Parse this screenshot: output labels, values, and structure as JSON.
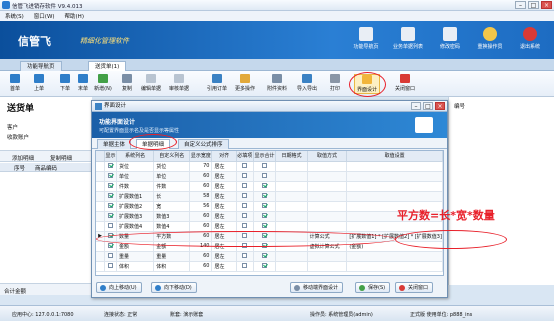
{
  "window": {
    "title": "信管飞进销存软件 V9.4.013",
    "controls": [
      "–",
      "□",
      "×"
    ]
  },
  "menu": [
    "系统(S)",
    "窗口(W)",
    "帮助(H)"
  ],
  "banner": {
    "brand": "信管飞",
    "slogan": "精细化管理软件",
    "buttons": [
      "功能导航页",
      "业务单据列表",
      "修改密码",
      "重换操作员",
      "退出系统"
    ]
  },
  "tabs": [
    "功能导航页",
    "送货单(1)"
  ],
  "toolbar": [
    "首单",
    "上单",
    "下单",
    "末单",
    "新增(N)",
    "复制",
    "编辑单据",
    "审核单据",
    "引用订单",
    "更多操作",
    "附件资料",
    "导入导出",
    "打印",
    "界面设计",
    "关闭窗口"
  ],
  "doc": {
    "title": "送货单",
    "label_customer": "客户",
    "label_account": "收款账户",
    "btn_add_row": "添加明细",
    "btn_copy_row": "复制明细",
    "col_no": "序号",
    "col_code": "商品编码",
    "total_label": "合计金额",
    "right_label": "编号"
  },
  "dialog": {
    "title": "界面设计",
    "header_title": "功能界面设计",
    "header_desc": "可配置界面显示名及是否显示等属性",
    "tabs": [
      "单据主体",
      "单据明细",
      "自定义公式排序"
    ],
    "columns": [
      "显示",
      "系统列名",
      "自定义列名",
      "显示宽度",
      "对齐",
      "必填项",
      "显示合计",
      "日期格式",
      "取值方式",
      "取值设置"
    ],
    "rows": [
      {
        "show": true,
        "sys": "货位",
        "custom": "货位",
        "width": "70",
        "align": "居左",
        "required": false,
        "total": false,
        "date": "",
        "mode": "",
        "setting": ""
      },
      {
        "show": true,
        "sys": "单位",
        "custom": "单位",
        "width": "60",
        "align": "居左",
        "required": false,
        "total": false,
        "date": "",
        "mode": "",
        "setting": ""
      },
      {
        "show": true,
        "sys": "件数",
        "custom": "件数",
        "width": "60",
        "align": "居左",
        "required": false,
        "total": true,
        "date": "",
        "mode": "",
        "setting": ""
      },
      {
        "show": true,
        "sys": "扩展数值1",
        "custom": "长",
        "width": "58",
        "align": "居左",
        "required": false,
        "total": true,
        "date": "",
        "mode": "",
        "setting": ""
      },
      {
        "show": true,
        "sys": "扩展数值2",
        "custom": "宽",
        "width": "56",
        "align": "居左",
        "required": false,
        "total": true,
        "date": "",
        "mode": "",
        "setting": ""
      },
      {
        "show": true,
        "sys": "扩展数值3",
        "custom": "数值3",
        "width": "60",
        "align": "居左",
        "required": false,
        "total": true,
        "date": "",
        "mode": "",
        "setting": ""
      },
      {
        "show": false,
        "sys": "扩展数值4",
        "custom": "数值4",
        "width": "60",
        "align": "居左",
        "required": false,
        "total": true,
        "date": "",
        "mode": "",
        "setting": ""
      },
      {
        "show": true,
        "sys": "数量",
        "custom": "平方数",
        "width": "60",
        "align": "居左",
        "required": false,
        "total": true,
        "date": "",
        "mode": "计算公式",
        "setting": "[扩展数值1] * [扩展数值2] * [扩展数值3]"
      },
      {
        "show": true,
        "sys": "金额",
        "custom": "金额",
        "width": "140",
        "align": "居左",
        "required": false,
        "total": true,
        "date": "",
        "mode": "虚拟计算公式",
        "setting": "(金额)"
      },
      {
        "show": false,
        "sys": "重量",
        "custom": "重量",
        "width": "60",
        "align": "居左",
        "required": false,
        "total": true,
        "date": "",
        "mode": "",
        "setting": ""
      },
      {
        "show": false,
        "sys": "体积",
        "custom": "体积",
        "width": "60",
        "align": "居左",
        "required": false,
        "total": true,
        "date": "",
        "mode": "",
        "setting": ""
      }
    ],
    "btn_up": "向上移动(U)",
    "btn_down": "向下移动(D)",
    "btn_move": "移动端界面设计",
    "btn_save": "保存(S)",
    "btn_close": "关闭窗口"
  },
  "annotation": "平方数=长*宽*数量",
  "status": {
    "server": "应用中心: 127.0.0.1:7080",
    "conn": "连接状态: 正常",
    "db": "账套: 演示账套",
    "operator": "操作员: 系统管理员(admin)",
    "version": "正式版 使用单位: p888_ins"
  },
  "colors": {
    "banner": "#1d6cc2",
    "annotation_red": "#e8202a",
    "accent": "#2a7bd0"
  }
}
